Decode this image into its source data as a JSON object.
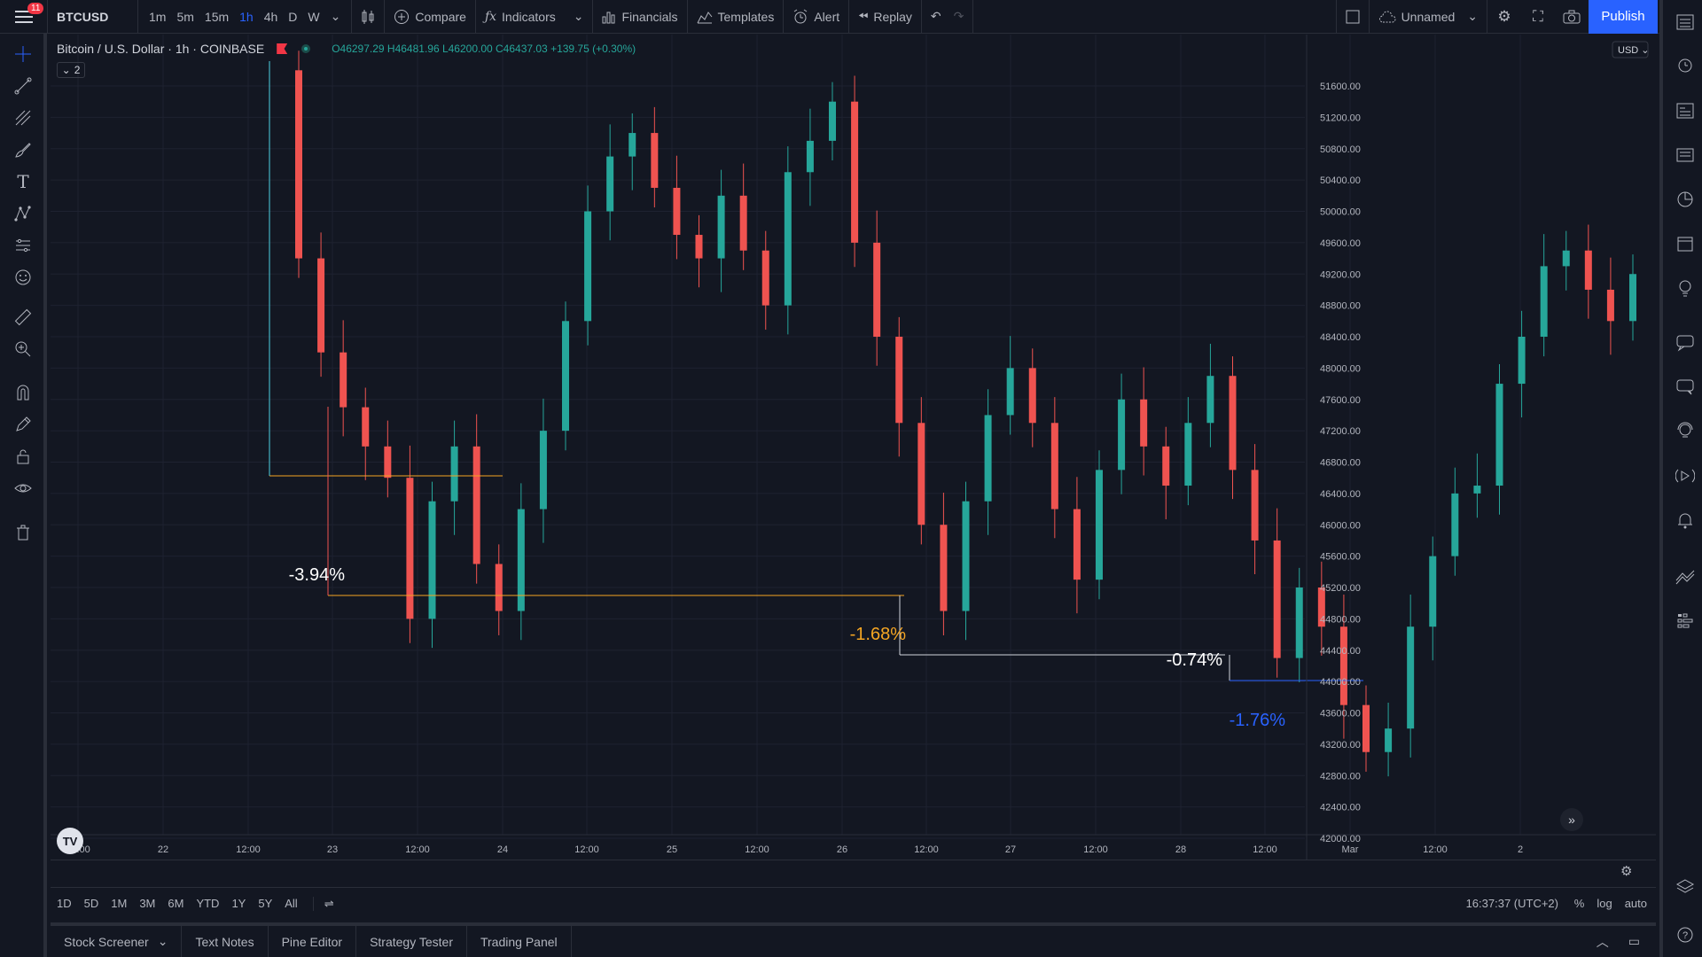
{
  "topbar": {
    "notification_count": "11",
    "symbol": "BTCUSD",
    "intervals": [
      "1m",
      "5m",
      "15m",
      "1h",
      "4h",
      "D",
      "W"
    ],
    "active_interval": "1h",
    "compare_label": "Compare",
    "indicators_label": "Indicators",
    "financials_label": "Financials",
    "templates_label": "Templates",
    "alert_label": "Alert",
    "replay_label": "Replay",
    "layout_name": "Unnamed",
    "publish_label": "Publish"
  },
  "legend": {
    "title": "Bitcoin / U.S. Dollar · 1h · COINBASE",
    "ohlc": "O46297.29 H46481.96 L46200.00 C46437.03 +139.75 (+0.30%)",
    "collapse_count": "2"
  },
  "price_axis": {
    "currency": "USD",
    "labels": [
      "51600.00",
      "51200.00",
      "50800.00",
      "50400.00",
      "50000.00",
      "49600.00",
      "49200.00",
      "48800.00",
      "48400.00",
      "48000.00",
      "47600.00",
      "47200.00",
      "46800.00",
      "46400.00",
      "46000.00",
      "45600.00",
      "45200.00",
      "44800.00",
      "44400.00",
      "44000.00",
      "43600.00",
      "43200.00",
      "42800.00",
      "42400.00",
      "42000.00"
    ]
  },
  "time_axis": {
    "labels": [
      "12:00",
      "22",
      "12:00",
      "23",
      "12:00",
      "24",
      "12:00",
      "25",
      "12:00",
      "26",
      "12:00",
      "27",
      "12:00",
      "28",
      "12:00",
      "Mar",
      "12:00",
      "2"
    ]
  },
  "annotations": [
    {
      "text": "-3.94%",
      "color": "#ffffff"
    },
    {
      "text": "-1.68%",
      "color": "#f5a623"
    },
    {
      "text": "-0.74%",
      "color": "#ffffff"
    },
    {
      "text": "-1.76%",
      "color": "#2962ff"
    }
  ],
  "timeframes": [
    "1D",
    "5D",
    "1M",
    "3M",
    "6M",
    "YTD",
    "1Y",
    "5Y",
    "All"
  ],
  "clock": "16:37:37 (UTC+2)",
  "scale_options": [
    "%",
    "log",
    "auto"
  ],
  "bottom_tabs": [
    "Stock Screener",
    "Text Notes",
    "Pine Editor",
    "Strategy Tester",
    "Trading Panel"
  ],
  "colors": {
    "up": "#26a69a",
    "down": "#ef5350",
    "background": "#131722",
    "accent": "#2962ff"
  },
  "chart_data": {
    "type": "candlestick",
    "symbol": "BTCUSD",
    "interval": "1h",
    "exchange": "COINBASE",
    "y_range": [
      41800,
      52000
    ],
    "candles_approx_close": [
      49400,
      48200,
      47500,
      47000,
      46600,
      44800,
      46300,
      47000,
      45500,
      44900,
      46200,
      47200,
      48600,
      50000,
      50700,
      51000,
      50300,
      49700,
      49400,
      50200,
      49500,
      48800,
      50500,
      50900,
      51400,
      49600,
      48400,
      47300,
      46000,
      44900,
      46300,
      47400,
      48000,
      47300,
      46200,
      45300,
      46700,
      47600,
      47000,
      46500,
      47300,
      47900,
      46700,
      45800,
      44300,
      45200,
      44700,
      43700,
      43100,
      43400,
      44700,
      45600,
      46400,
      46500,
      47800,
      48400,
      49300,
      49500,
      49000,
      48600,
      49200
    ]
  }
}
